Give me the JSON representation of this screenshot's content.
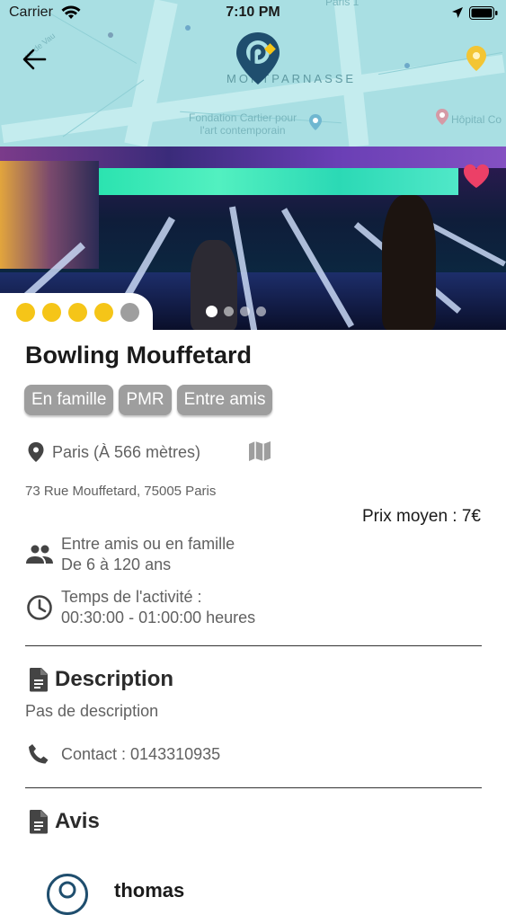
{
  "status_bar": {
    "carrier": "Carrier",
    "time": "7:10 PM"
  },
  "map": {
    "labels": {
      "top_right": "Paris 1",
      "rue": "ue de Vau",
      "quarter": "MONTPARNASSE",
      "fondation": "Fondation Cartier pour\nl'art contemporain",
      "hopital": "Hôpital Co"
    }
  },
  "place": {
    "name": "Bowling Mouffetard",
    "rating": {
      "filled": 4,
      "total": 5,
      "filled_color": "#f5c518",
      "empty_color": "#9e9e9e"
    },
    "gallery": {
      "count": 4,
      "current": 1
    },
    "favorite": true,
    "tags": [
      "En famille",
      "PMR",
      "Entre amis"
    ],
    "location": "Paris (À 566 mètres)",
    "address": "73 Rue Mouffetard, 75005 Paris",
    "price": "Prix moyen : 7€",
    "audience_line1": "Entre amis ou en famille",
    "audience_line2": "De 6 à 120 ans",
    "duration_line1": "Temps de l'activité :",
    "duration_line2": "00:30:00 - 01:00:00 heures"
  },
  "description": {
    "title": "Description",
    "text": "Pas de description",
    "contact": "Contact : 0143310935"
  },
  "reviews": {
    "title": "Avis",
    "items": [
      {
        "author": "thomas"
      }
    ]
  },
  "colors": {
    "heart": "#ec4067",
    "logo": "#1f4e6e",
    "logo_accent": "#f5c518"
  }
}
